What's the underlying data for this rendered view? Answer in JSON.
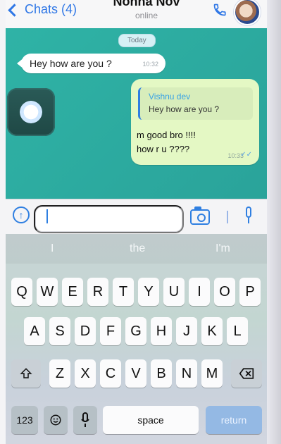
{
  "header": {
    "back_label": "Chats (4)",
    "contact_name": "Nonna Nov",
    "status": "online"
  },
  "chat": {
    "date_badge": "Today",
    "incoming": {
      "text": "Hey how are you ?",
      "time": "10:32"
    },
    "outgoing": {
      "quoted_name": "Vishnu dev",
      "quoted_text": "Hey how are you ?",
      "line1": "m good bro !!!!",
      "line2": "how r u ????",
      "time": "10:33",
      "ticks": "✓✓"
    }
  },
  "input": {
    "placeholder": ""
  },
  "keyboard": {
    "suggestions": [
      "I",
      "the",
      "I'm"
    ],
    "row1": [
      "Q",
      "W",
      "E",
      "R",
      "T",
      "Y",
      "U",
      "I",
      "O",
      "P"
    ],
    "row2": [
      "A",
      "S",
      "D",
      "F",
      "G",
      "H",
      "J",
      "K",
      "L"
    ],
    "row3": [
      "Z",
      "X",
      "C",
      "V",
      "B",
      "N",
      "M"
    ],
    "numbers_label": "123",
    "space_label": "space",
    "return_label": "return"
  },
  "colors": {
    "accent": "#2f7fe1",
    "chat_bg": "#2fb3a6"
  }
}
